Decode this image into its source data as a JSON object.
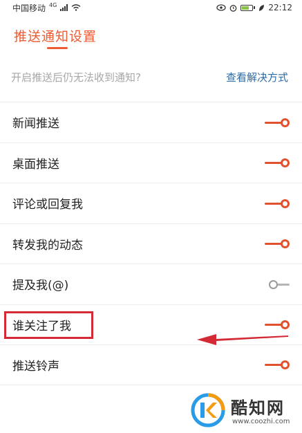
{
  "status_bar": {
    "carrier": "中国移动",
    "network": "4G",
    "time": "22:12"
  },
  "header": {
    "title": "推送通知设置"
  },
  "help": {
    "question": "开启推送后仍无法收到通知?",
    "link": "查看解决方式"
  },
  "settings": [
    {
      "label": "新闻推送",
      "enabled": true
    },
    {
      "label": "桌面推送",
      "enabled": true
    },
    {
      "label": "评论或回复我",
      "enabled": true
    },
    {
      "label": "转发我的动态",
      "enabled": true
    },
    {
      "label": "提及我(@)",
      "enabled": false
    },
    {
      "label": "谁关注了我",
      "enabled": true
    },
    {
      "label": "推送铃声",
      "enabled": true
    }
  ],
  "watermark": {
    "name": "酷知网",
    "url": "www.coozhi.com"
  },
  "colors": {
    "accent": "#ee5a31",
    "toggle_on": "#e0512c",
    "link": "#2d6aa3",
    "annotation": "#d32a36"
  }
}
